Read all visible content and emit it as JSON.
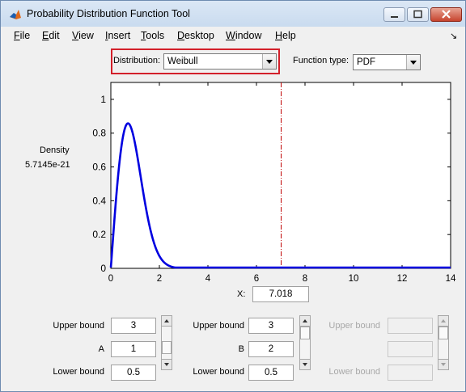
{
  "window": {
    "title": "Probability Distribution Function Tool"
  },
  "menu": [
    {
      "label": "File",
      "underline": "F"
    },
    {
      "label": "Edit",
      "underline": "E"
    },
    {
      "label": "View",
      "underline": "V"
    },
    {
      "label": "Insert",
      "underline": "I"
    },
    {
      "label": "Tools",
      "underline": "T"
    },
    {
      "label": "Desktop",
      "underline": "D"
    },
    {
      "label": "Window",
      "underline": "W"
    },
    {
      "label": "Help",
      "underline": "H"
    }
  ],
  "controls": {
    "distribution_label": "Distribution:",
    "distribution_value": "Weibull",
    "function_type_label": "Function type:",
    "function_type_value": "PDF"
  },
  "readout": {
    "label": "Density",
    "value": "5.7145e-21"
  },
  "x_field": {
    "label": "X:",
    "value": "7.018"
  },
  "params": [
    {
      "upper_label": "Upper bound",
      "upper": "3",
      "name": "A",
      "value": "1",
      "lower_label": "Lower bound",
      "lower": "0.5",
      "enabled": true
    },
    {
      "upper_label": "Upper bound",
      "upper": "3",
      "name": "B",
      "value": "2",
      "lower_label": "Lower bound",
      "lower": "0.5",
      "enabled": true
    },
    {
      "upper_label": "Upper bound",
      "upper": "",
      "name": "",
      "value": "",
      "lower_label": "Lower bound",
      "lower": "",
      "enabled": false
    }
  ],
  "chart_data": {
    "type": "line",
    "xlim": [
      0,
      14
    ],
    "ylim": [
      0,
      1.1
    ],
    "xticks": [
      0,
      2,
      4,
      6,
      8,
      10,
      12,
      14
    ],
    "yticks": [
      0,
      0.2,
      0.4,
      0.6,
      0.8,
      1
    ],
    "series": [
      {
        "color": "#0000e0",
        "distribution": "weibull",
        "A": 1,
        "B": 2
      }
    ],
    "marker_x": 7.018,
    "marker_color": "#c00000"
  }
}
